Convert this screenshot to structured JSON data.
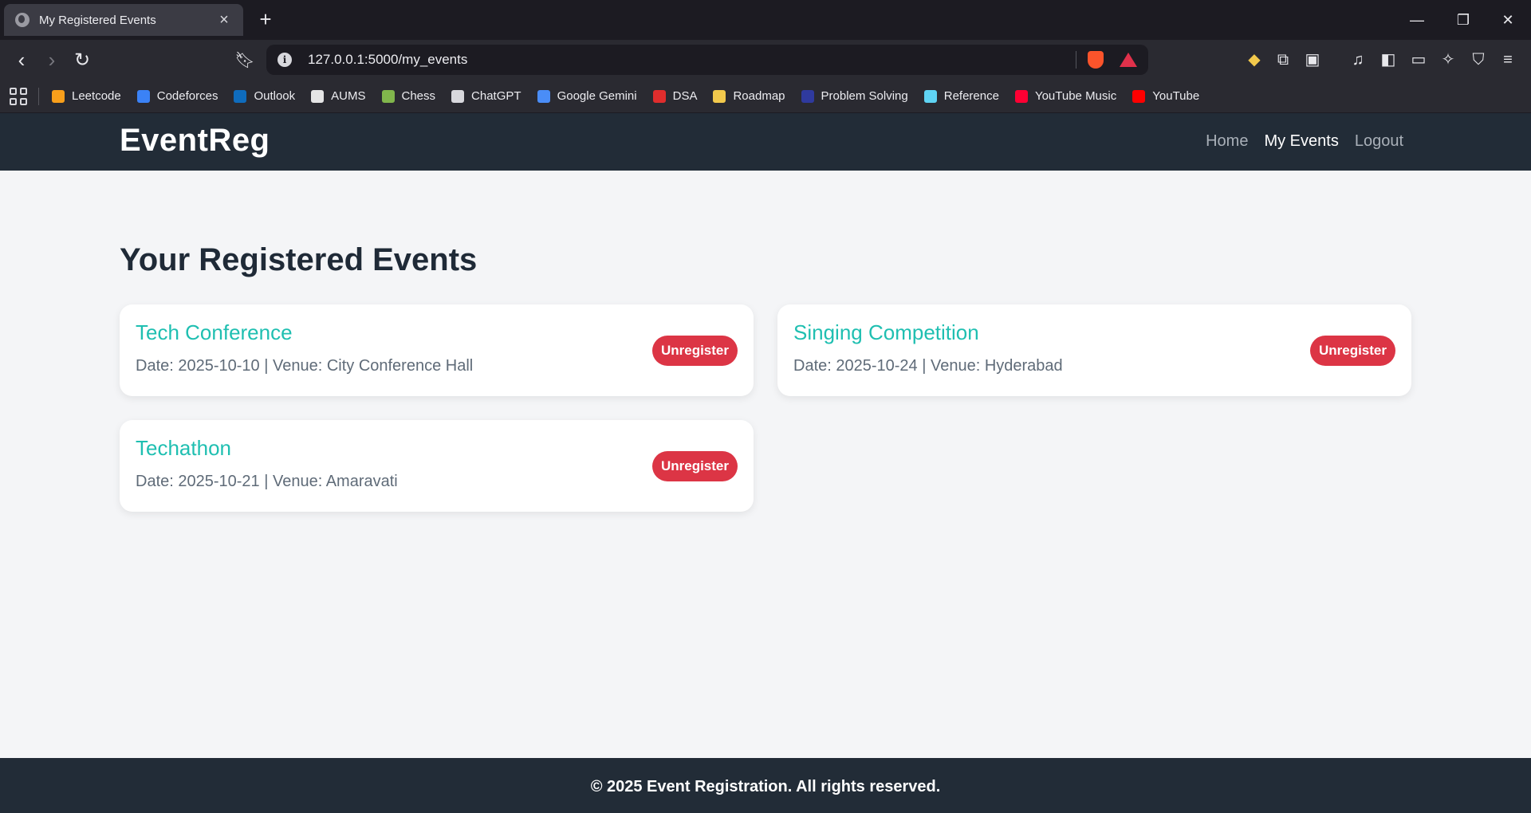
{
  "browser": {
    "tab_title": "My Registered Events",
    "url": "127.0.0.1:5000/my_events",
    "bookmarks": [
      {
        "label": "Leetcode",
        "icon": "leetcode-icon",
        "color": "#f89f1b"
      },
      {
        "label": "Codeforces",
        "icon": "codeforces-icon",
        "color": "#3b82f6"
      },
      {
        "label": "Outlook",
        "icon": "outlook-icon",
        "color": "#0f6cbd"
      },
      {
        "label": "AUMS",
        "icon": "aums-icon",
        "color": "#e5e5e5"
      },
      {
        "label": "Chess",
        "icon": "chess-icon",
        "color": "#81b64c"
      },
      {
        "label": "ChatGPT",
        "icon": "chatgpt-icon",
        "color": "#d8d8dd"
      },
      {
        "label": "Google Gemini",
        "icon": "gemini-icon",
        "color": "#4a8df7"
      },
      {
        "label": "DSA",
        "icon": "dsa-icon",
        "color": "#e02d2d"
      },
      {
        "label": "Roadmap",
        "icon": "rocket-icon",
        "color": "#f2c94c"
      },
      {
        "label": "Problem Solving",
        "icon": "gauge-icon",
        "color": "#2f3a9e"
      },
      {
        "label": "Reference",
        "icon": "react-icon",
        "color": "#5fd3f3"
      },
      {
        "label": "YouTube Music",
        "icon": "youtube-music-icon",
        "color": "#ff0033"
      },
      {
        "label": "YouTube",
        "icon": "youtube-icon",
        "color": "#ff0000"
      }
    ]
  },
  "header": {
    "brand": "EventReg",
    "nav": [
      {
        "label": "Home",
        "active": false
      },
      {
        "label": "My Events",
        "active": true
      },
      {
        "label": "Logout",
        "active": false
      }
    ]
  },
  "main": {
    "title": "Your Registered Events",
    "events": [
      {
        "title": "Tech Conference",
        "meta": "Date: 2025-10-10 | Venue: City Conference Hall",
        "action": "Unregister"
      },
      {
        "title": "Singing Competition",
        "meta": "Date: 2025-10-24 | Venue: Hyderabad",
        "action": "Unregister"
      },
      {
        "title": "Techathon",
        "meta": "Date: 2025-10-21 | Venue: Amaravati",
        "action": "Unregister"
      }
    ]
  },
  "footer": {
    "text": "© 2025 Event Registration. All rights reserved."
  },
  "colors": {
    "header_bg": "#222c37",
    "accent": "#1fbfb1",
    "danger": "#dc3545"
  }
}
